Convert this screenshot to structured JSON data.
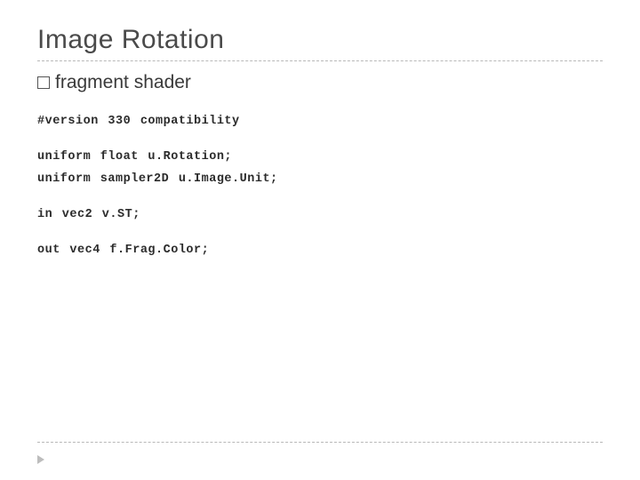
{
  "title": "Image Rotation",
  "bullet": {
    "label": "fragment shader"
  },
  "code": {
    "l1": "#version 330 compatibility",
    "l2": "uniform float u.Rotation;",
    "l3": "uniform sampler2D u.Image.Unit;",
    "l4": "in vec2 v.ST;",
    "l5": "out vec4 f.Frag.Color;"
  }
}
